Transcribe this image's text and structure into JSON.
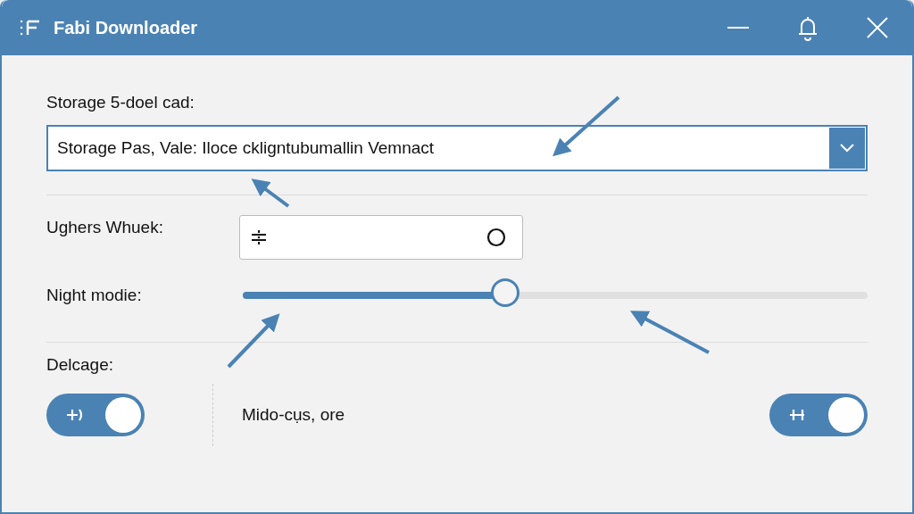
{
  "window": {
    "title": "Fabi Downloader"
  },
  "storage": {
    "label": "Storage 5-doel cad:",
    "value": "Storage Pas, Vale: Iloce ckligntubumallin Vemnact"
  },
  "ughers": {
    "label": "Ughers Whuek:"
  },
  "night_mode": {
    "label": "Night modie:",
    "level": 0.42
  },
  "delcage": {
    "label": "Delcage:",
    "text": "Mido-cụs, ore",
    "toggles": [
      {
        "on": true
      },
      {
        "on": true
      }
    ]
  }
}
